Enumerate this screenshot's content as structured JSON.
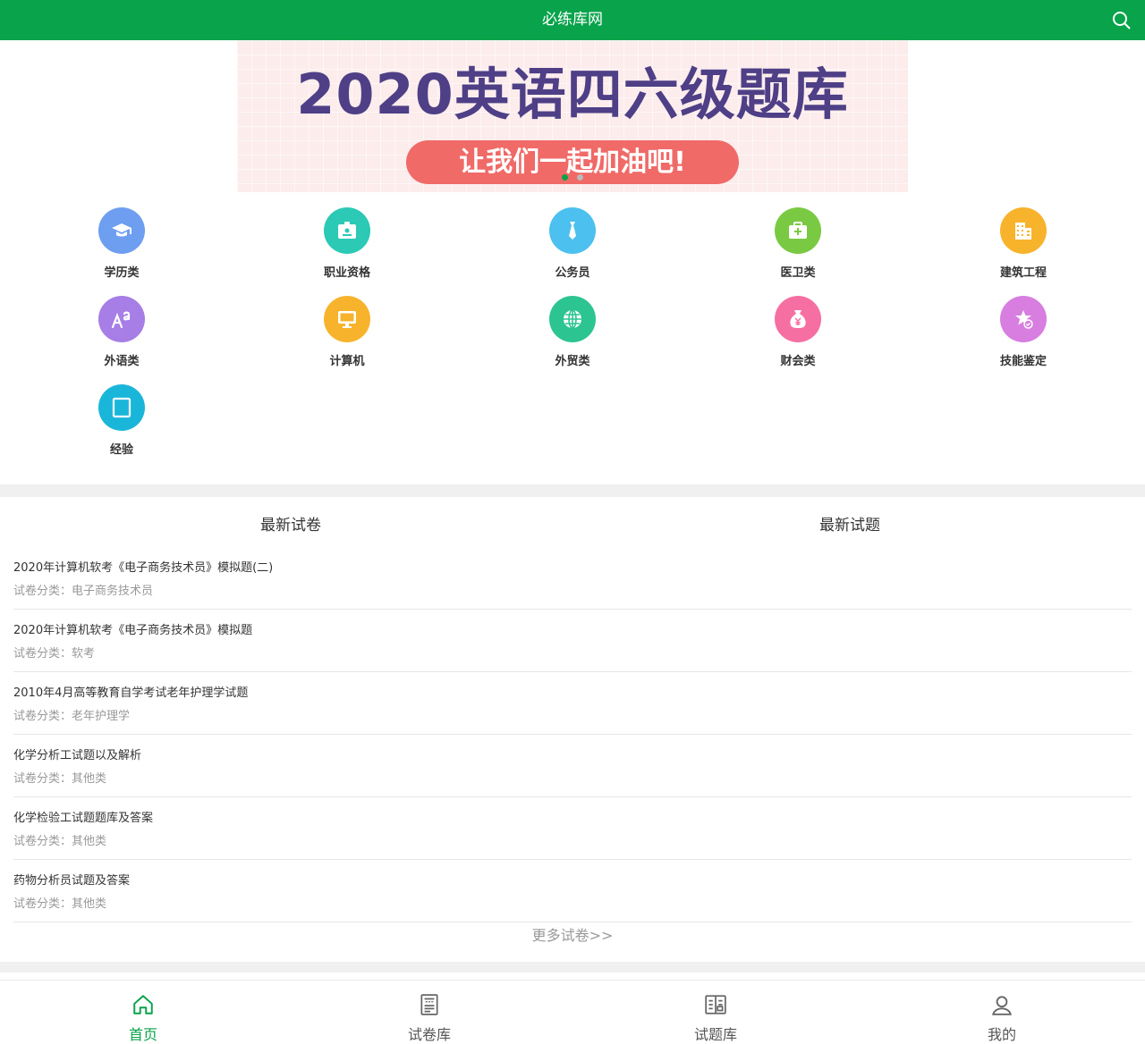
{
  "header": {
    "title": "必练库网",
    "search_icon": "search-icon"
  },
  "banner": {
    "title": "2020英语四六级题库",
    "pill": "让我们一起加油吧!",
    "slides": 2,
    "active_slide": 1
  },
  "categories": [
    {
      "label": "学历类",
      "icon": "graduation-cap-icon",
      "color": "#6e9ef0"
    },
    {
      "label": "职业资格",
      "icon": "id-badge-icon",
      "color": "#2cc9b5"
    },
    {
      "label": "公务员",
      "icon": "necktie-icon",
      "color": "#4cc0ee"
    },
    {
      "label": "医卫类",
      "icon": "medical-kit-icon",
      "color": "#7ac943"
    },
    {
      "label": "建筑工程",
      "icon": "building-icon",
      "color": "#f8b32c"
    },
    {
      "label": "外语类",
      "icon": "letters-icon",
      "color": "#a77de6"
    },
    {
      "label": "计算机",
      "icon": "monitor-icon",
      "color": "#f8b32c"
    },
    {
      "label": "外贸类",
      "icon": "globe-icon",
      "color": "#2cc491"
    },
    {
      "label": "财会类",
      "icon": "money-bag-icon",
      "color": "#f66fa2"
    },
    {
      "label": "技能鉴定",
      "icon": "skill-badge-icon",
      "color": "#d77ee0"
    },
    {
      "label": "经验",
      "icon": "book-icon",
      "color": "#1ab6da"
    }
  ],
  "tabs": {
    "papers": "最新试卷",
    "questions": "最新试题"
  },
  "papers": [
    {
      "title": "2020年计算机软考《电子商务技术员》模拟题(二)",
      "category": "试卷分类：电子商务技术员"
    },
    {
      "title": "2020年计算机软考《电子商务技术员》模拟题",
      "category": "试卷分类：软考"
    },
    {
      "title": "2010年4月高等教育自学考试老年护理学试题",
      "category": "试卷分类：老年护理学"
    },
    {
      "title": "化学分析工试题以及解析",
      "category": "试卷分类：其他类"
    },
    {
      "title": "化学检验工试题题库及答案",
      "category": "试卷分类：其他类"
    },
    {
      "title": "药物分析员试题及答案",
      "category": "试卷分类：其他类"
    }
  ],
  "more_link": "更多试卷>>",
  "bottom_nav": [
    {
      "label": "首页",
      "icon": "home-icon",
      "active": true
    },
    {
      "label": "试卷库",
      "icon": "paper-icon",
      "active": false
    },
    {
      "label": "试题库",
      "icon": "question-bank-icon",
      "active": false
    },
    {
      "label": "我的",
      "icon": "user-icon",
      "active": false
    }
  ],
  "colors": {
    "brand_green": "#08a34b",
    "banner_title": "#4e3f86",
    "banner_pill": "#f06a67"
  }
}
